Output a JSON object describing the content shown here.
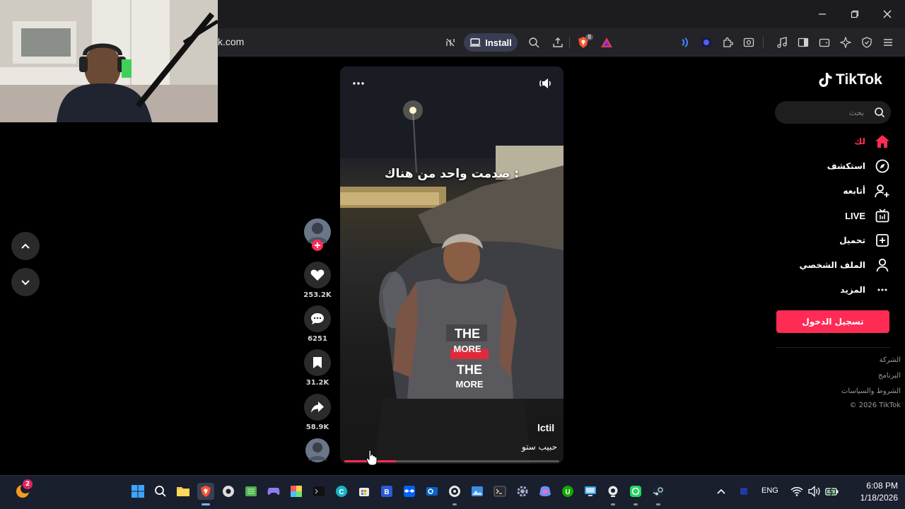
{
  "browser": {
    "url": "k.com",
    "install_label": "Install",
    "brave_badge": "8"
  },
  "video": {
    "caption": "صدمت واحد من هناك :",
    "username": "lctil",
    "description": "حبيب ستو",
    "progress": 0.24
  },
  "actions": {
    "likes": "253.2K",
    "comments": "6251",
    "saves": "31.2K",
    "shares": "58.9K"
  },
  "sidebar": {
    "logo": "TikTok",
    "search_placeholder": "بحث",
    "items": [
      {
        "label": "لك",
        "icon": "home-icon",
        "active": true
      },
      {
        "label": "استكشف",
        "icon": "compass-icon"
      },
      {
        "label": "أتابعه",
        "icon": "following-icon"
      },
      {
        "label": "LIVE",
        "icon": "live-icon"
      },
      {
        "label": "تحميل",
        "icon": "upload-icon"
      },
      {
        "label": "الملف الشخصي",
        "icon": "profile-icon"
      },
      {
        "label": "المزيد",
        "icon": "more-icon"
      }
    ],
    "login_label": "تسجيل الدخول",
    "footer": [
      "الشركة",
      "البرنامج",
      "الشروط والسياسات",
      "© 2026 TikTok"
    ]
  },
  "taskbar": {
    "notification_count": "2",
    "language": "ENG",
    "time": "6:08 PM",
    "date": "1/18/2026"
  },
  "colors": {
    "accent": "#fe2c55",
    "taskbar": "#1a1f2e"
  }
}
